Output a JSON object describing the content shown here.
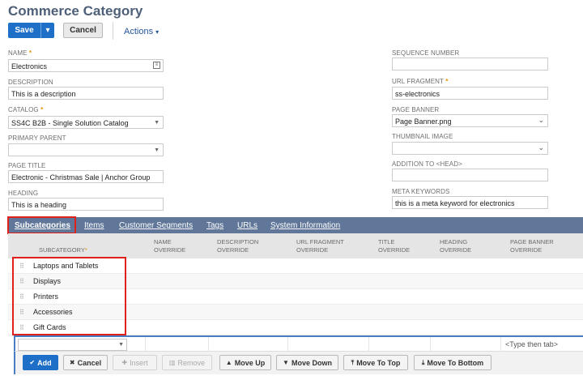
{
  "page": {
    "title": "Commerce Category"
  },
  "toolbar": {
    "save_label": "Save",
    "cancel_label": "Cancel",
    "actions_label": "Actions"
  },
  "fields": {
    "name": {
      "label": "NAME",
      "value": "Electronics"
    },
    "description": {
      "label": "DESCRIPTION",
      "value": "This is a description"
    },
    "catalog": {
      "label": "CATALOG",
      "value": "SS4C B2B - Single Solution Catalog"
    },
    "primary_parent": {
      "label": "PRIMARY PARENT",
      "value": ""
    },
    "page_title": {
      "label": "PAGE TITLE",
      "value": "Electronic - Christmas Sale | Anchor Group"
    },
    "heading": {
      "label": "HEADING",
      "value": "This is a heading"
    },
    "sequence_number": {
      "label": "SEQUENCE NUMBER",
      "value": ""
    },
    "url_fragment": {
      "label": "URL FRAGMENT",
      "value": "ss-electronics"
    },
    "page_banner": {
      "label": "PAGE BANNER",
      "value": "Page Banner.png"
    },
    "thumbnail_image": {
      "label": "THUMBNAIL IMAGE",
      "value": ""
    },
    "addition_to_head": {
      "label": "ADDITION TO <HEAD>",
      "value": ""
    },
    "meta_keywords": {
      "label": "META KEYWORDS",
      "value": "this is a meta keyword for electronics"
    }
  },
  "tabs": [
    "Subcategories",
    "Items",
    "Customer Segments",
    "Tags",
    "URLs",
    "System Information"
  ],
  "table": {
    "headers": {
      "subcategory": "SUBCATEGORY",
      "name_override_1": "NAME",
      "name_override_2": "OVERRIDE",
      "description_override_1": "DESCRIPTION",
      "description_override_2": "OVERRIDE",
      "url_fragment_override_1": "URL FRAGMENT",
      "url_fragment_override_2": "OVERRIDE",
      "title_override_1": "TITLE",
      "title_override_2": "OVERRIDE",
      "heading_override_1": "HEADING",
      "heading_override_2": "OVERRIDE",
      "page_banner_override_1": "PAGE BANNER",
      "page_banner_override_2": "OVERRIDE"
    },
    "rows": [
      "Laptops and Tablets",
      "Displays",
      "Printers",
      "Accessories",
      "Gift Cards"
    ],
    "edit_row": {
      "placeholder": "<Type then tab>"
    }
  },
  "list_buttons": {
    "add": "Add",
    "cancel": "Cancel",
    "insert": "Insert",
    "remove": "Remove",
    "move_up": "Move Up",
    "move_down": "Move Down",
    "move_to_top": "Move To Top",
    "move_to_bottom": "Move To Bottom"
  },
  "colors": {
    "primary": "#1e6fc7",
    "tabbar": "#607799",
    "highlight": "#e0201b",
    "required": "#e69300"
  }
}
